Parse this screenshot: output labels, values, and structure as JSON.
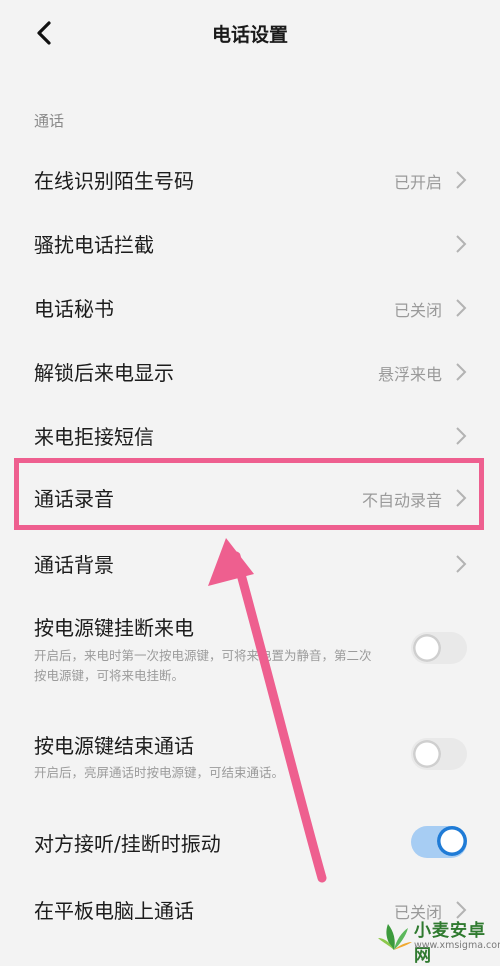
{
  "header": {
    "title": "电话设置"
  },
  "section": {
    "label": "通话"
  },
  "rows": {
    "online_id": {
      "label": "在线识别陌生号码",
      "value": "已开启"
    },
    "harass_block": {
      "label": "骚扰电话拦截"
    },
    "secretary": {
      "label": "电话秘书",
      "value": "已关闭"
    },
    "unlock_display": {
      "label": "解锁后来电显示",
      "value": "悬浮来电"
    },
    "reject_sms": {
      "label": "来电拒接短信"
    },
    "recording": {
      "label": "通话录音",
      "value": "不自动录音"
    },
    "background": {
      "label": "通话背景"
    },
    "power_hangup": {
      "label": "按电源键挂断来电",
      "desc": "开启后，来电时第一次按电源键，可将来电置为静音，第二次按电源键，可将来电挂断。",
      "enabled": false
    },
    "power_end": {
      "label": "按电源键结束通话",
      "desc": "开启后，亮屏通话时按电源键，可结束通话。",
      "enabled": false
    },
    "vibrate": {
      "label": "对方接听/挂断时振动",
      "enabled": true
    },
    "tablet": {
      "label": "在平板电脑上通话",
      "value": "已关闭"
    }
  },
  "watermark": {
    "text": "小麦安卓网",
    "url": "www.xmsigma.com"
  },
  "colors": {
    "highlight": "#ee5f8f",
    "toggle_on": "#1f7bd6",
    "value_text": "#9a9a9a"
  }
}
